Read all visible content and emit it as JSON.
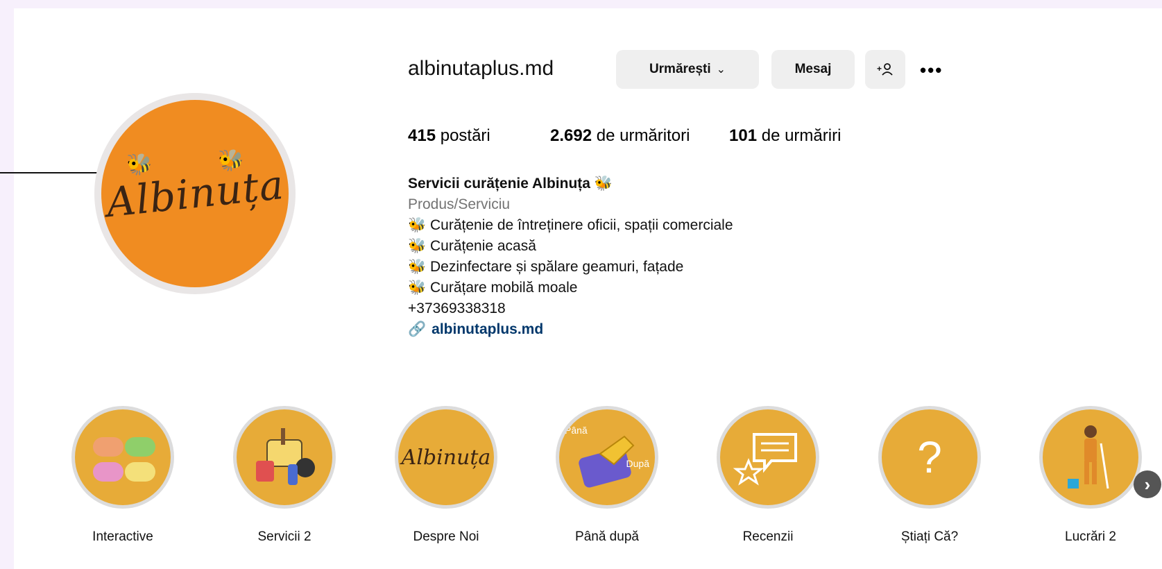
{
  "profile": {
    "username": "albinutaplus.md",
    "avatar_text": "Albinuța",
    "buttons": {
      "follow": "Urmărești",
      "message": "Mesaj",
      "suggest_icon": "+&",
      "more": "•••"
    },
    "stats": {
      "posts_count": "415",
      "posts_label": "postări",
      "followers_count": "2.692",
      "followers_label": "de urmăritori",
      "following_count": "101",
      "following_label": "de urmăriri"
    },
    "bio": {
      "name": "Servicii curățenie Albinuța 🐝",
      "category": "Produs/Serviciu",
      "lines": [
        "🐝 Curățenie de întreținere oficii, spații comerciale",
        "🐝 Curățenie acasă",
        "🐝 Dezinfectare și spălare geamuri, fațade",
        "🐝 Curățare mobilă moale"
      ],
      "phone": "+37369338318",
      "link_icon": "🔗",
      "link": "albinutaplus.md"
    }
  },
  "highlights": [
    {
      "label": "Interactive",
      "icon": "soaps"
    },
    {
      "label": "Servicii 2",
      "icon": "cleaning-tools"
    },
    {
      "label": "Despre Noi",
      "icon": "albinuta-logo",
      "text": "Albinuța"
    },
    {
      "label": "Până după",
      "icon": "glove-cloth",
      "text_a": "Până",
      "text_b": "După"
    },
    {
      "label": "Recenzii",
      "icon": "chat-star"
    },
    {
      "label": "Știați Că?",
      "icon": "question-mark"
    },
    {
      "label": "Lucrări 2",
      "icon": "cleaner-person"
    }
  ],
  "colors": {
    "background": "#f7f0fc",
    "avatar": "#f08c21",
    "highlight": "#e7ab38",
    "link": "#00376b"
  }
}
